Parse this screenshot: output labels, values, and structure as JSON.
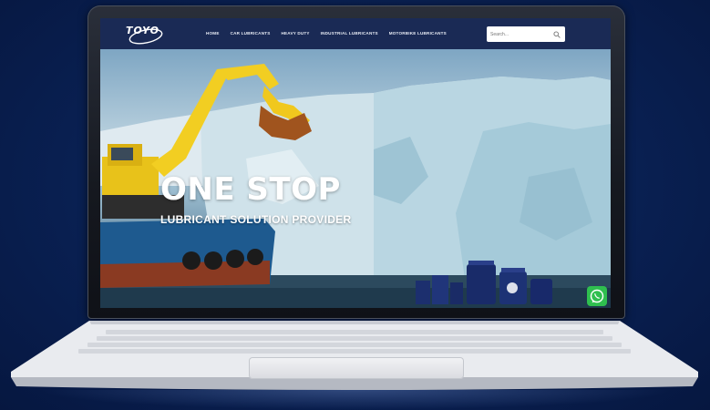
{
  "header": {
    "logo_text": "TOYO",
    "nav_items": [
      {
        "label": "HOME"
      },
      {
        "label": "CAR LUBRICANTS"
      },
      {
        "label": "HEAVY DUTY"
      },
      {
        "label": "INDUSTRIAL LUBRICANTS"
      },
      {
        "label": "MOTORBIKE LUBRICANTS"
      }
    ],
    "search": {
      "placeholder": "Search..."
    }
  },
  "hero": {
    "title": "ONE STOP",
    "subtitle": "LUBRICANT SOLUTION PROVIDER"
  },
  "icons": {
    "search": "search-icon",
    "whatsapp": "whatsapp-icon",
    "logo": "toyo-logo"
  },
  "colors": {
    "background": "#0a2256",
    "navbar": "#1a2a55",
    "whatsapp": "#2fbf4f",
    "excavator": "#e8c21a"
  }
}
